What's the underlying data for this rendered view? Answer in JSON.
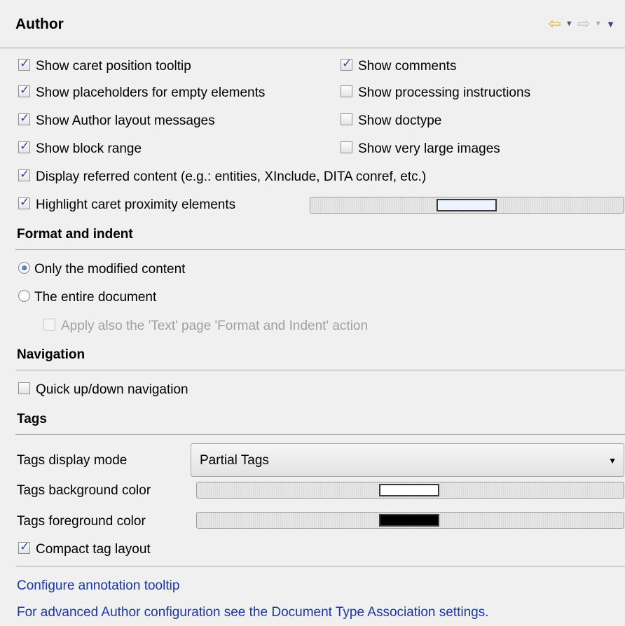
{
  "header": {
    "title": "Author",
    "back_icon": "back-arrow-icon",
    "forward_icon": "forward-arrow-icon"
  },
  "options_left": [
    {
      "label": "Show caret position tooltip",
      "checked": true
    },
    {
      "label": "Show placeholders for empty elements",
      "checked": true
    },
    {
      "label": "Show Author layout messages",
      "checked": true
    },
    {
      "label": "Show block range",
      "checked": true
    }
  ],
  "options_right": [
    {
      "label": "Show comments",
      "checked": true
    },
    {
      "label": "Show processing instructions",
      "checked": false
    },
    {
      "label": "Show doctype",
      "checked": false
    },
    {
      "label": "Show very large images",
      "checked": false
    }
  ],
  "display_referred": {
    "label": "Display referred content (e.g.: entities, XInclude, DITA conref, etc.)",
    "checked": true
  },
  "highlight_caret": {
    "label": "Highlight caret proximity elements",
    "checked": true,
    "color": "#eef4ff"
  },
  "format_indent": {
    "title": "Format and indent",
    "only_modified": {
      "label": "Only the modified content",
      "selected": true
    },
    "entire_document": {
      "label": "The entire document",
      "selected": false
    },
    "apply_text": {
      "label": "Apply also the 'Text' page 'Format and Indent' action",
      "checked": false,
      "enabled": false
    }
  },
  "navigation": {
    "title": "Navigation",
    "quick_nav": {
      "label": "Quick up/down navigation",
      "checked": false
    }
  },
  "tags": {
    "title": "Tags",
    "display_mode_label": "Tags display mode",
    "display_mode_value": "Partial Tags",
    "bg_label": "Tags background color",
    "bg_color": "#ffffff",
    "fg_label": "Tags foreground color",
    "fg_color": "#000000",
    "compact": {
      "label": "Compact tag layout",
      "checked": true
    }
  },
  "links": {
    "configure": "Configure annotation tooltip",
    "advanced": "For advanced Author configuration see the Document Type Association settings."
  }
}
